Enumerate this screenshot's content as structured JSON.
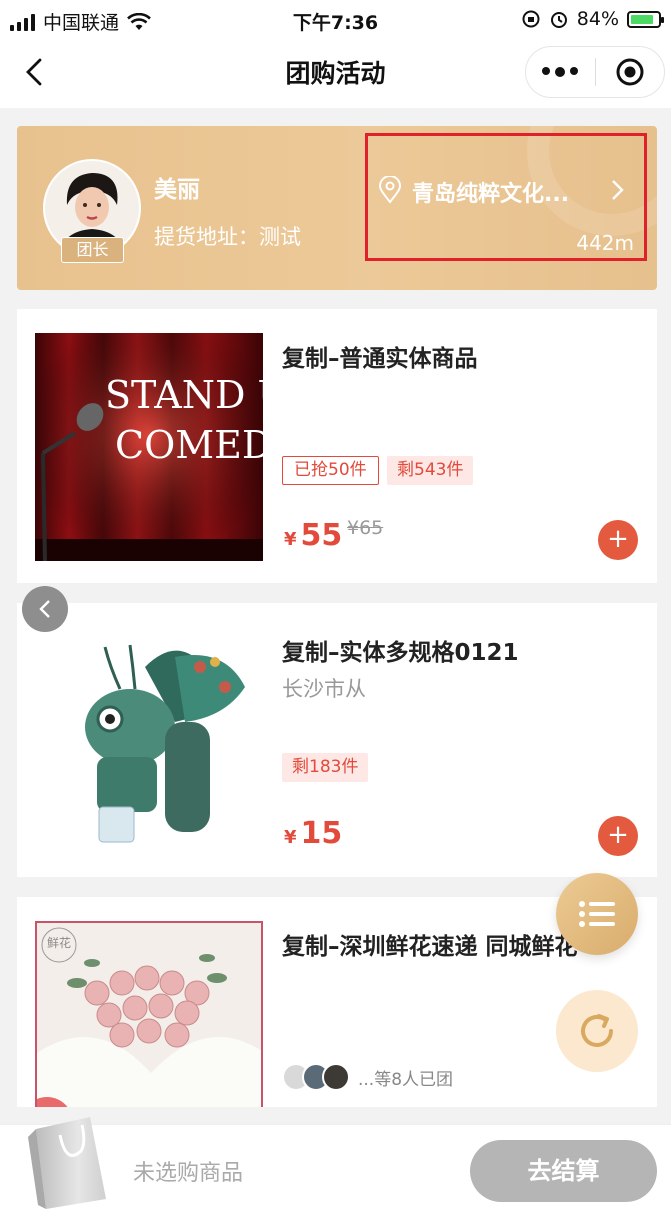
{
  "status_bar": {
    "carrier": "中国联通",
    "time": "下午7:36",
    "battery_percent": "84%",
    "battery_level": 0.84
  },
  "nav": {
    "title": "团购活动"
  },
  "leader": {
    "name": "美丽",
    "badge": "团长",
    "address": "提货地址：测试",
    "location_name": "青岛纯粹文化...",
    "distance": "442m"
  },
  "products": [
    {
      "name": "复制–普通实体商品",
      "image_text": [
        "STAND U",
        "COMEDY"
      ],
      "tags": [
        "已抢50件",
        "剩543件"
      ],
      "currency": "¥",
      "price": "55",
      "original_price": "¥65",
      "add_label": "+"
    },
    {
      "name": "复制–实体多规格0121",
      "subtitle": "长沙市从",
      "tags": [
        "剩183件"
      ],
      "currency": "¥",
      "price": "15",
      "add_label": "+"
    },
    {
      "name": "复制–深圳鲜花速递 同城鲜花",
      "image_text": "鲜花",
      "members_text": "...等8人已团"
    }
  ],
  "bottom": {
    "cart_status": "未选购商品",
    "checkout_label": "去结算"
  },
  "colors": {
    "accent": "#e24a3b",
    "gold": "#e8c28e",
    "highlight_border": "#e0202a"
  },
  "icons": [
    "back-chevron-icon",
    "more-dots-icon",
    "target-icon",
    "location-pin-icon",
    "chevron-right-icon",
    "chevron-left-icon",
    "list-icon",
    "refresh-icon",
    "shopping-bag-icon"
  ]
}
